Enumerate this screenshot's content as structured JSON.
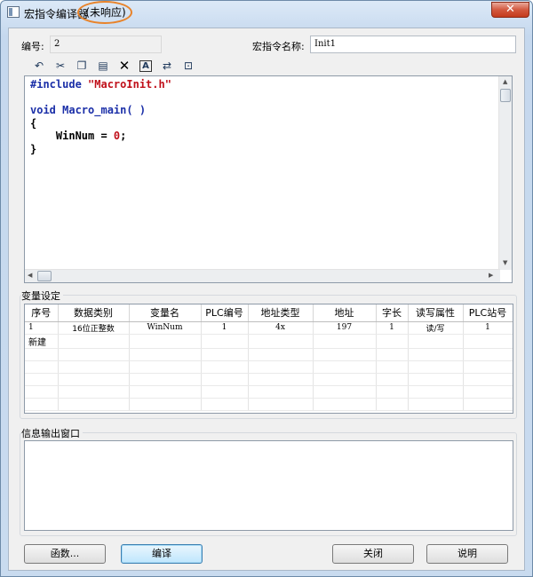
{
  "window": {
    "title": "宏指令编译器",
    "status": "(未响应)",
    "close_label": "✕"
  },
  "form": {
    "number_label": "编号:",
    "number_value": "2",
    "macro_name_label": "宏指令名称:",
    "macro_name_value": "Init1"
  },
  "toolbar": {
    "icons": [
      "undo-icon",
      "cut-icon",
      "copy-icon",
      "paste-icon",
      "delete-icon",
      "font-icon",
      "replace-icon",
      "export-icon"
    ]
  },
  "code": {
    "lines": [
      [
        "#include ",
        "\"MacroInit.h\""
      ],
      [
        ""
      ],
      [
        "void Macro_main( )"
      ],
      [
        "{"
      ],
      [
        "    WinNum = ",
        "0",
        ";"
      ],
      [
        "}"
      ]
    ]
  },
  "variables": {
    "section_label": "变量设定",
    "columns": [
      "序号",
      "数据类别",
      "变量名",
      "PLC编号",
      "地址类型",
      "地址",
      "字长",
      "读写属性",
      "PLC站号"
    ],
    "rows": [
      [
        "1",
        "16位正整数",
        "WinNum",
        "1",
        "4x",
        "197",
        "1",
        "读/写",
        "1"
      ],
      [
        "新建",
        "",
        "",
        "",
        "",
        "",
        "",
        "",
        ""
      ]
    ]
  },
  "output": {
    "section_label": "信息输出窗口"
  },
  "buttons": {
    "functions": "函数...",
    "compile": "编译",
    "close": "关闭",
    "help": "说明"
  }
}
